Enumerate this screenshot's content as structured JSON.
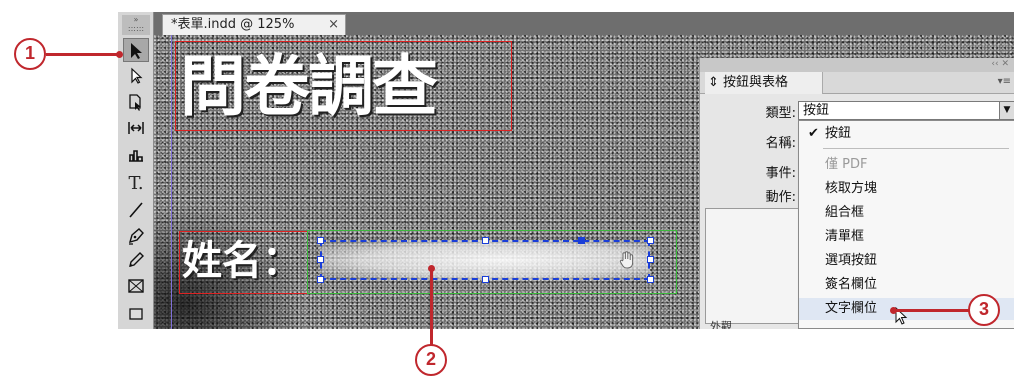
{
  "document_tab": {
    "title": "*表單.indd @ 125%",
    "close": "×"
  },
  "toolbox": {
    "tools": [
      {
        "name": "selection-tool-icon"
      },
      {
        "name": "direct-selection-tool-icon"
      },
      {
        "name": "page-tool-icon"
      },
      {
        "name": "gap-tool-icon"
      },
      {
        "name": "content-collector-icon"
      },
      {
        "name": "type-tool-icon",
        "glyph": "T."
      },
      {
        "name": "line-tool-icon"
      },
      {
        "name": "pen-tool-icon"
      },
      {
        "name": "pencil-tool-icon"
      },
      {
        "name": "rectangle-frame-tool-icon"
      },
      {
        "name": "rectangle-tool-icon"
      }
    ]
  },
  "canvas": {
    "title_text": "問卷調查",
    "name_label": "姓名："
  },
  "panel": {
    "title": "按鈕與表格",
    "type_label": "類型:",
    "type_value": "按鈕",
    "name_label": "名稱:",
    "event_label": "事件:",
    "action_label": "動作:",
    "bottom_label": "外觀"
  },
  "dropdown": {
    "options": [
      {
        "label": "按鈕",
        "checked": true,
        "disabled": false
      },
      {
        "label": "僅 PDF",
        "checked": false,
        "disabled": true
      },
      {
        "label": "核取方塊",
        "checked": false,
        "disabled": false
      },
      {
        "label": "組合框",
        "checked": false,
        "disabled": false
      },
      {
        "label": "清單框",
        "checked": false,
        "disabled": false
      },
      {
        "label": "選項按鈕",
        "checked": false,
        "disabled": false
      },
      {
        "label": "簽名欄位",
        "checked": false,
        "disabled": false
      },
      {
        "label": "文字欄位",
        "checked": false,
        "disabled": false,
        "hovered": true
      }
    ]
  },
  "callouts": [
    "1",
    "2",
    "3"
  ],
  "colors": {
    "callout": "#c0272d",
    "frame_red": "#dd2222",
    "frame_green": "#3cb83c",
    "selection_blue": "#1a3ed8"
  }
}
